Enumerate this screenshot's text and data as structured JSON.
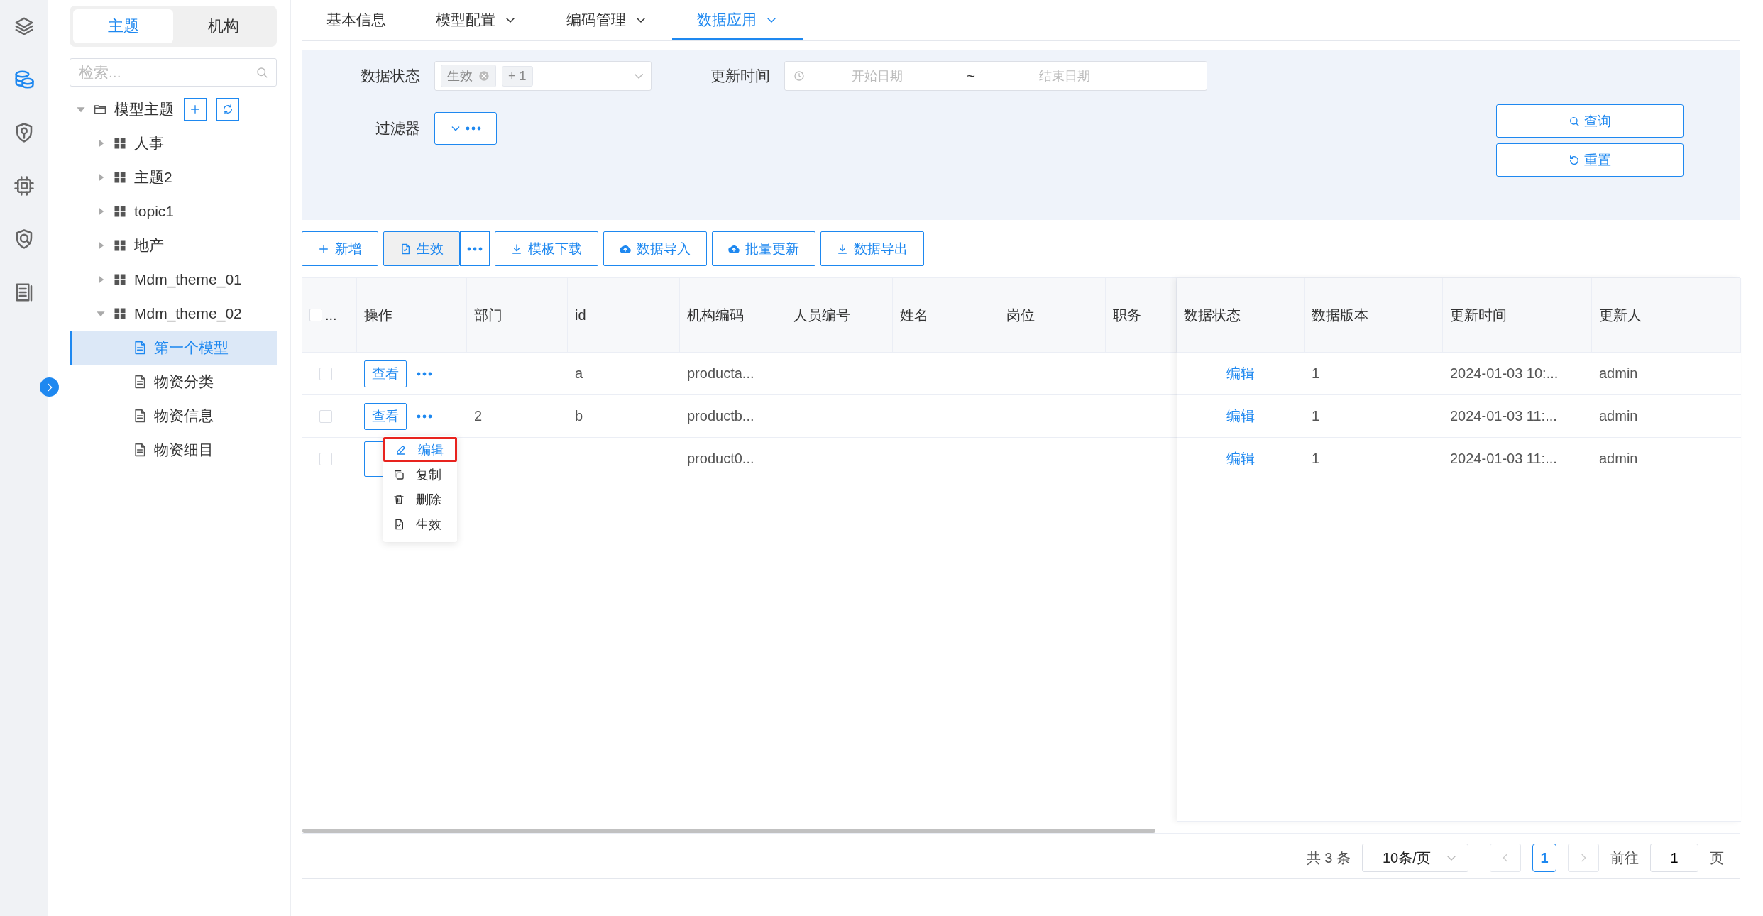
{
  "rail": {
    "items": [
      {
        "selected": false
      },
      {
        "selected": true
      },
      {
        "selected": false
      },
      {
        "selected": false
      },
      {
        "selected": false
      },
      {
        "selected": false
      }
    ]
  },
  "tree_panel": {
    "tabs": [
      {
        "label": "主题",
        "selected": true
      },
      {
        "label": "机构",
        "selected": false
      }
    ],
    "search": {
      "placeholder": "检索..."
    },
    "tree": [
      {
        "label": "模型主题",
        "kind": "folder",
        "expanded": true,
        "children": [
          {
            "label": "人事",
            "kind": "theme",
            "expanded": false
          },
          {
            "label": "主题2",
            "kind": "theme",
            "expanded": false
          },
          {
            "label": "topic1",
            "kind": "theme",
            "expanded": false
          },
          {
            "label": "地产",
            "kind": "theme",
            "expanded": false
          },
          {
            "label": "Mdm_theme_01",
            "kind": "theme",
            "expanded": false
          },
          {
            "label": "Mdm_theme_02",
            "kind": "theme",
            "expanded": true,
            "children": [
              {
                "label": "第一个模型",
                "kind": "model",
                "selected": true
              },
              {
                "label": "物资分类",
                "kind": "model",
                "selected": false
              },
              {
                "label": "物资信息",
                "kind": "model",
                "selected": false
              },
              {
                "label": "物资细目",
                "kind": "model",
                "selected": false
              }
            ]
          }
        ]
      }
    ]
  },
  "top_tabs": [
    {
      "label": "基本信息",
      "dropdown": false,
      "selected": false
    },
    {
      "label": "模型配置",
      "dropdown": true,
      "selected": false
    },
    {
      "label": "编码管理",
      "dropdown": true,
      "selected": false
    },
    {
      "label": "数据应用",
      "dropdown": true,
      "selected": true
    }
  ],
  "filters": {
    "status": {
      "label": "数据状态",
      "tags": [
        "生效"
      ],
      "more": "+ 1"
    },
    "time": {
      "label": "更新时间",
      "start_placeholder": "开始日期",
      "separator": "~",
      "end_placeholder": "结束日期"
    },
    "filter": {
      "label": "过滤器"
    },
    "buttons": [
      {
        "label": "查询"
      },
      {
        "label": "重置"
      }
    ]
  },
  "toolbar": [
    {
      "label": "新增",
      "kind": "normal"
    },
    {
      "label": "生效",
      "kind": "split"
    },
    {
      "label": "模板下载",
      "kind": "normal"
    },
    {
      "label": "数据导入",
      "kind": "normal"
    },
    {
      "label": "批量更新",
      "kind": "normal"
    },
    {
      "label": "数据导出",
      "kind": "normal"
    }
  ],
  "table": {
    "all_selected": false,
    "columns": [
      "...",
      "操作",
      "部门",
      "id",
      "机构编码",
      "人员编号",
      "姓名",
      "岗位",
      "职务",
      "数据状态",
      "数据版本",
      "更新时间",
      "更新人"
    ],
    "rows": [
      {
        "selected": false,
        "action": "查看",
        "dept": "",
        "id": "a",
        "org_code": "producta...",
        "status": "编辑",
        "version": "1",
        "updated": "2024-01-03 10:...",
        "updater": "admin"
      },
      {
        "selected": false,
        "action": "查看",
        "dept": "2",
        "id": "b",
        "org_code": "productb...",
        "status": "编辑",
        "version": "1",
        "updated": "2024-01-03 11:...",
        "updater": "admin"
      },
      {
        "selected": false,
        "dept": "",
        "id": "",
        "org_code": "product0...",
        "status": "编辑",
        "version": "1",
        "updated": "2024-01-03 11:...",
        "updater": "admin"
      }
    ]
  },
  "menu": {
    "items": [
      {
        "label": "编辑",
        "highlighted": true
      },
      {
        "label": "复制",
        "highlighted": false
      },
      {
        "label": "删除",
        "highlighted": false
      },
      {
        "label": "生效",
        "highlighted": false
      }
    ]
  },
  "pagination": {
    "total": "共 3 条",
    "page_size": "10条/页",
    "pages": [
      {
        "label": "1",
        "selected": true
      }
    ],
    "goto_label": "前往",
    "goto_value": "1",
    "page_unit": "页"
  }
}
